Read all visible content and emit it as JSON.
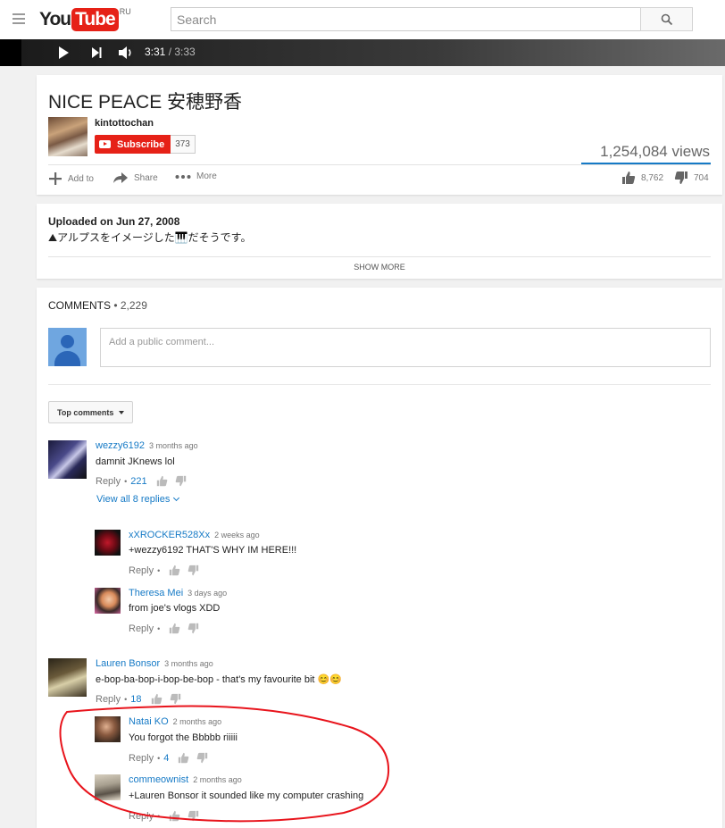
{
  "header": {
    "logo_you": "You",
    "logo_tube": "Tube",
    "logo_region": "RU",
    "search_placeholder": "Search"
  },
  "player": {
    "current_time": "3:31",
    "duration": "/ 3:33"
  },
  "video": {
    "title": "NICE PEACE 安穂野香",
    "channel": "kintottochan",
    "subscribe_label": "Subscribe",
    "subscriber_count": "373",
    "views": "1,254,084 views",
    "actions": {
      "add_to": "Add to",
      "share": "Share",
      "more": "More"
    },
    "likes": "8,762",
    "dislikes": "704"
  },
  "description": {
    "uploaded": "Uploaded on Jun 27, 2008",
    "text": "⛰アルプスをイメージした🎹だそうです。",
    "show_more": "SHOW MORE"
  },
  "comments_section": {
    "title": "COMMENTS",
    "count": "• 2,229",
    "input_placeholder": "Add a public comment...",
    "sort_label": "Top comments",
    "view_all_replies": "View all 8 replies",
    "reply_label": "Reply",
    "items": [
      {
        "author": "wezzy6192",
        "ago": "3 months ago",
        "text": "damnit JKnews lol",
        "likes": "221"
      },
      {
        "author": "xXROCKER528Xx",
        "ago": "2 weeks ago",
        "text": "+wezzy6192 THAT'S WHY IM HERE!!!",
        "likes": ""
      },
      {
        "author": "Theresa Mei",
        "ago": "3 days ago",
        "text": "from joe's vlogs XDD",
        "likes": ""
      },
      {
        "author": "Lauren Bonsor",
        "ago": "3 months ago",
        "text": "e-bop-ba-bop-i-bop-be-bop - that's my favourite bit 😊😊",
        "likes": "18"
      },
      {
        "author": "Natai KO",
        "ago": "2 months ago",
        "text": "You forgot the Bbbbb riiiii",
        "likes": "4"
      },
      {
        "author": "commeownist",
        "ago": "2 months ago",
        "text": "+Lauren Bonsor it sounded like my computer crashing",
        "likes": ""
      }
    ]
  },
  "colors": {
    "brand_red": "#e62117",
    "link_blue": "#167ac6",
    "annotation_red": "#e8141c"
  }
}
